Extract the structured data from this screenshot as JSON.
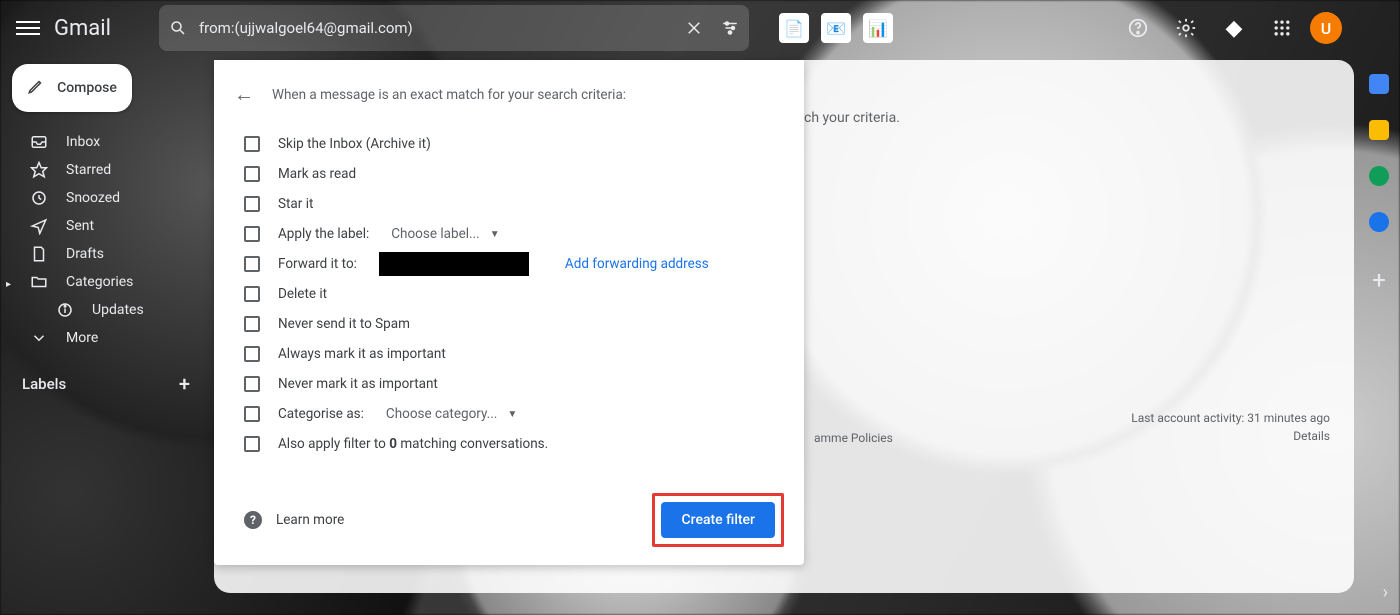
{
  "brand": "Gmail",
  "search": {
    "query": "from:(ujjwalgoel64@gmail.com)"
  },
  "avatar": {
    "initial": "U"
  },
  "compose_label": "Compose",
  "sidebar": {
    "items": [
      {
        "label": "Inbox"
      },
      {
        "label": "Starred"
      },
      {
        "label": "Snoozed"
      },
      {
        "label": "Sent"
      },
      {
        "label": "Drafts"
      },
      {
        "label": "Categories"
      },
      {
        "label": "Updates"
      },
      {
        "label": "More"
      }
    ],
    "labels_header": "Labels"
  },
  "content": {
    "criteria_snippet": "ch your criteria.",
    "footer_activity": "Last account activity: 31 minutes ago",
    "footer_details": "Details",
    "footer_policies": "amme Policies"
  },
  "dialog": {
    "header": "When a message is an exact match for your search criteria:",
    "options": {
      "skip_inbox": "Skip the Inbox (Archive it)",
      "mark_read": "Mark as read",
      "star": "Star it",
      "apply_label_prefix": "Apply the label:",
      "apply_label_value": "Choose label...",
      "forward_prefix": "Forward it to:",
      "forward_link": "Add forwarding address",
      "delete": "Delete it",
      "never_spam": "Never send it to Spam",
      "always_important": "Always mark it as important",
      "never_important": "Never mark it as important",
      "categorise_prefix": "Categorise as:",
      "categorise_value": "Choose category...",
      "also_apply_prefix": "Also apply filter to ",
      "also_apply_count": "0",
      "also_apply_suffix": " matching conversations."
    },
    "learn_more": "Learn more",
    "create_button": "Create filter"
  }
}
